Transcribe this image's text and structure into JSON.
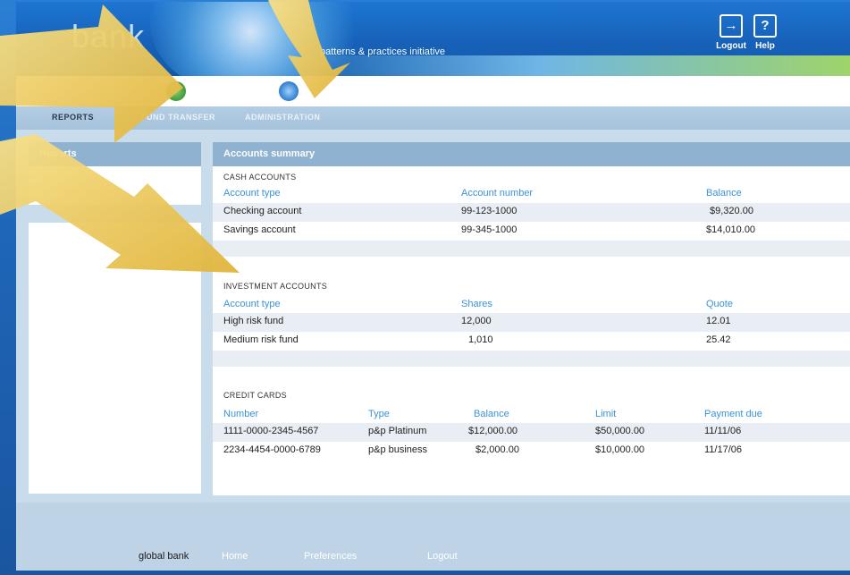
{
  "header": {
    "brand": "global bank",
    "brand_fragment": "bank",
    "tagline": "patterns & practices initiative",
    "logout_label": "Logout",
    "help_label": "Help"
  },
  "nav": {
    "items": [
      {
        "label": "REPORTS"
      },
      {
        "label": "FUND TRANSFER"
      },
      {
        "label": "ADMINISTRATION"
      }
    ]
  },
  "left_panel": {
    "title": "Reports"
  },
  "main": {
    "title": "Accounts summary",
    "cash": {
      "title": "CASH ACCOUNTS",
      "columns": [
        "Account type",
        "Account number",
        "Balance"
      ],
      "rows": [
        [
          "Checking account",
          "99-123-1000",
          "$9,320.00"
        ],
        [
          "Savings account",
          "99-345-1000",
          "$14,010.00"
        ]
      ]
    },
    "investment": {
      "title": "INVESTMENT ACCOUNTS",
      "columns": [
        "Account type",
        "Shares",
        "Quote"
      ],
      "rows": [
        [
          "High risk fund",
          "12,000",
          "12.01"
        ],
        [
          "Medium risk fund",
          "1,010",
          "25.42"
        ]
      ]
    },
    "credit": {
      "title": "CREDIT CARDS",
      "columns": [
        "Number",
        "Type",
        "Balance",
        "Limit",
        "Payment due"
      ],
      "rows": [
        [
          "1111-0000-2345-4567",
          "p&p Platinum",
          "$12,000.00",
          "$50,000.00",
          "11/11/06"
        ],
        [
          "2234-4454-0000-6789",
          "p&p business",
          "$2,000.00",
          "$10,000.00",
          "11/17/06"
        ]
      ]
    }
  },
  "footer": {
    "brand": "global bank",
    "links": [
      "Home",
      "Preferences",
      "Logout"
    ]
  },
  "colors": {
    "header_blue": "#1761b9",
    "panel_header": "#8eb2d0",
    "column_header": "#3a93d8",
    "arrow": "#f2cf5b"
  }
}
